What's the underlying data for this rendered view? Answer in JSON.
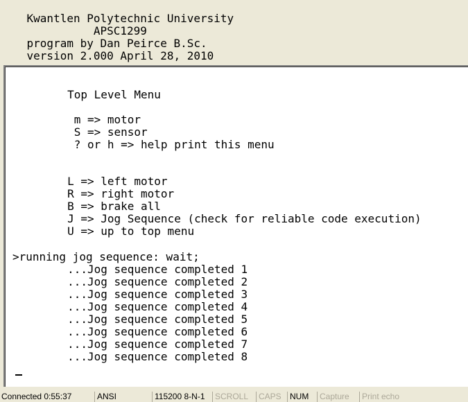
{
  "header": {
    "lines": [
      "    Kwantlen Polytechnic University",
      "              APSC1299",
      "    program by Dan Peirce B.Sc.",
      "    version 2.000 April 28, 2010"
    ]
  },
  "terminal": {
    "lines": [
      "        Top Level Menu",
      "",
      "         m => motor",
      "         S => sensor",
      "         ? or h => help print this menu",
      "",
      "",
      "        L => left motor",
      "        R => right motor",
      "        B => brake all",
      "        J => Jog Sequence (check for reliable code execution)",
      "        U => up to top menu",
      "",
      ">running jog sequence: wait;",
      "        ...Jog sequence completed 1",
      "        ...Jog sequence completed 2",
      "        ...Jog sequence completed 3",
      "        ...Jog sequence completed 4",
      "        ...Jog sequence completed 5",
      "        ...Jog sequence completed 6",
      "        ...Jog sequence completed 7",
      "        ...Jog sequence completed 8"
    ]
  },
  "statusbar": {
    "connected": "Connected 0:55:37",
    "encoding": "ANSI",
    "port_settings": "115200 8-N-1",
    "scroll": "SCROLL",
    "caps": "CAPS",
    "num": "NUM",
    "capture": "Capture",
    "print_echo": "Print echo"
  },
  "colors": {
    "frame": "#ece9d8",
    "terminal_bg": "#ffffff",
    "text": "#000000",
    "disabled": "#aca899"
  }
}
